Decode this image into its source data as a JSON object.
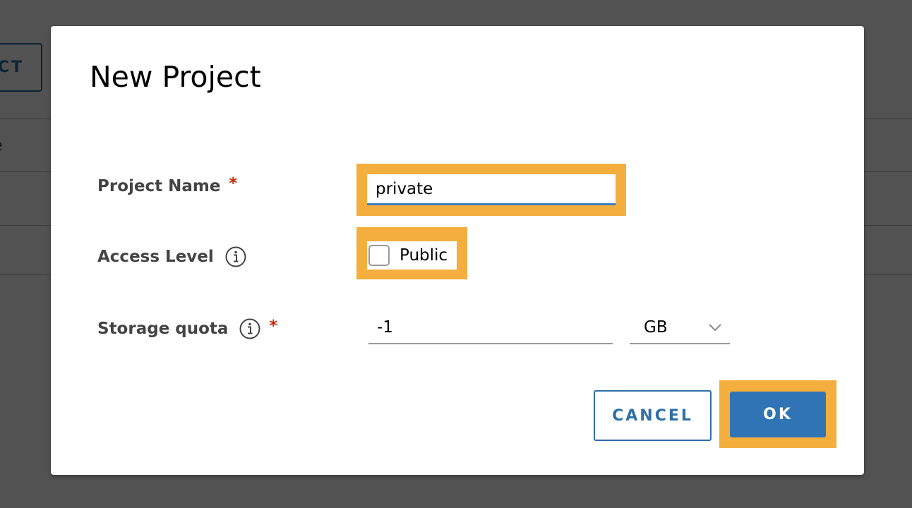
{
  "background": {
    "button_label": "CT",
    "column_header": "e"
  },
  "dialog": {
    "title": "New Project",
    "fields": {
      "project_name": {
        "label": "Project Name",
        "required_mark": "*",
        "value": "private"
      },
      "access_level": {
        "label": "Access Level",
        "checkbox_label": "Public",
        "checked": false
      },
      "storage_quota": {
        "label": "Storage quota",
        "required_mark": "*",
        "value": "-1",
        "unit_selected": "GB"
      }
    },
    "buttons": {
      "cancel": "CANCEL",
      "ok": "OK"
    }
  },
  "colors": {
    "highlight": "#f4ae3d",
    "primary": "#3074b5",
    "required": "#c92100",
    "input_focus_underline": "#3f7fbf"
  },
  "icons": [
    "info-icon",
    "chevron-down-icon"
  ]
}
